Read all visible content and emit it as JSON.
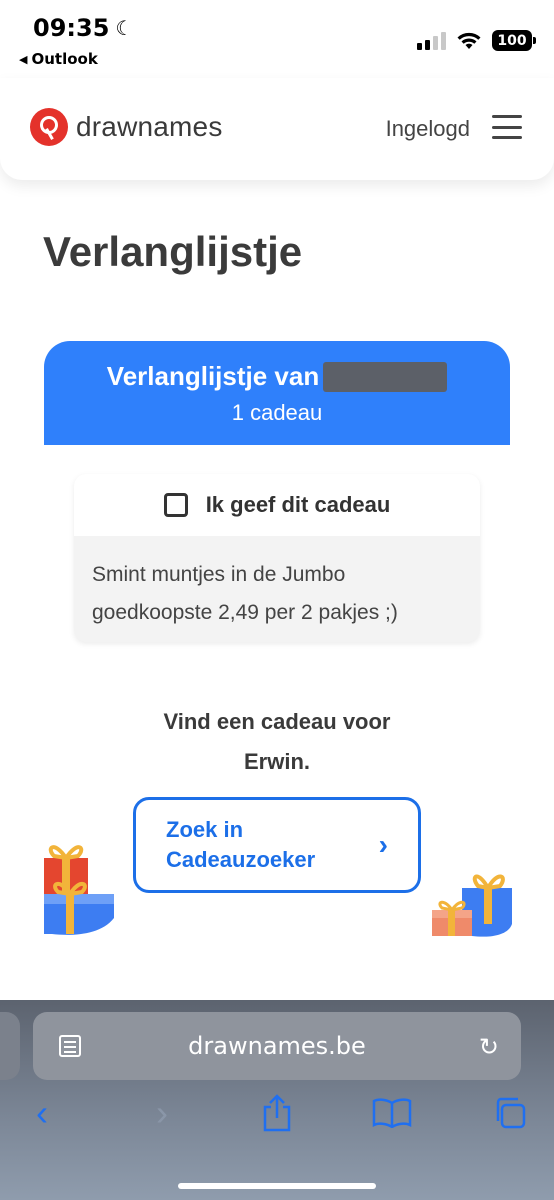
{
  "status_bar": {
    "time": "09:35",
    "back_app": "Outlook",
    "battery": "100"
  },
  "header": {
    "logo_text": "drawnames",
    "login_status": "Ingelogd"
  },
  "main": {
    "page_title": "Verlanglijstje",
    "list_owner_prefix": "Verlanglijstje van",
    "gift_count": "1 cadeau",
    "gift_card": {
      "checkbox_label": "Ik geef dit cadeau",
      "description_line1": "Smint muntjes in de Jumbo",
      "description_line2": "goedkoopste 2,49 per 2 pakjes ;)"
    },
    "find_gift_line1": "Vind een cadeau voor",
    "find_gift_line2": "Erwin.",
    "search_button_line1": "Zoek in",
    "search_button_line2": "Cadeauzoeker"
  },
  "browser": {
    "url": "drawnames.be"
  },
  "colors": {
    "brand_red": "#e4322b",
    "list_header_blue": "#2f80fb",
    "link_blue": "#1c6fe8"
  }
}
